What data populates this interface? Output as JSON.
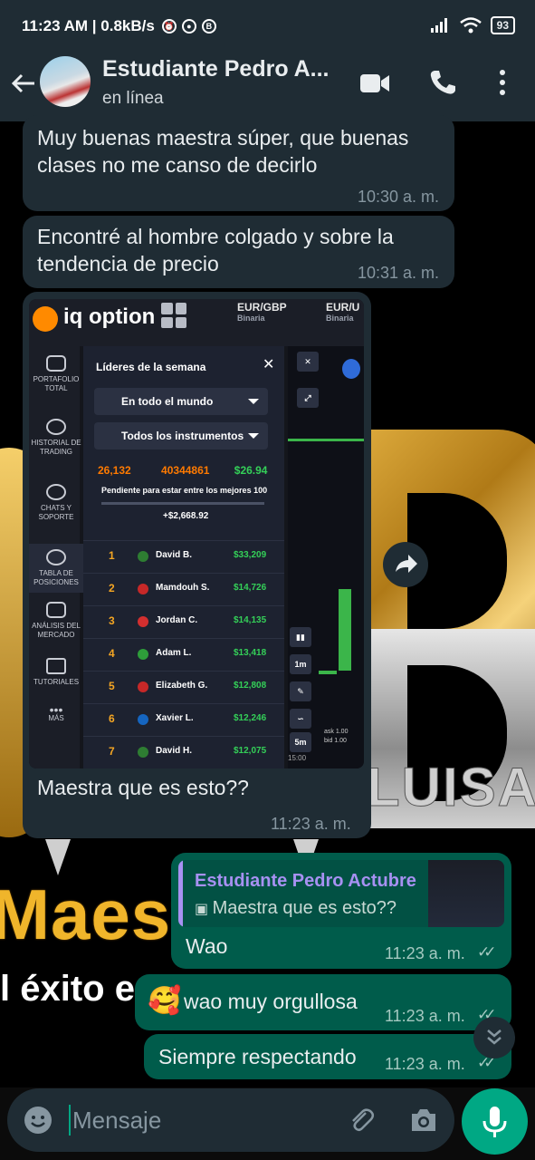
{
  "status_bar": {
    "time_speed": "11:23 AM | 0.8kB/s",
    "battery": "93"
  },
  "chat_header": {
    "name": "Estudiante Pedro A...",
    "status": "en línea"
  },
  "messages": [
    {
      "text": "Muy buenas maestra súper, que buenas clases no me canso de decirlo",
      "time": "10:30 a. m."
    },
    {
      "text": "Encontré al hombre colgado y sobre la tendencia de precio",
      "time": "10:31 a. m."
    },
    {
      "text": "Maestra que es esto??",
      "time": "11:23 a. m."
    },
    {
      "text": "Wao",
      "time": "11:23 a. m."
    },
    {
      "text": "wao muy orgullosa",
      "time": "11:23 a. m."
    },
    {
      "text": "Siempre respectando",
      "time": "11:23 a. m."
    }
  ],
  "reply": {
    "name": "Estudiante Pedro Actubre",
    "text": "Maestra que es esto??"
  },
  "shared_image": {
    "app_name": "iq option",
    "pairs": [
      "EUR/GBP",
      "EUR/U"
    ],
    "pair_type": "Binaria",
    "sidebar": [
      "PORTAFOLIO TOTAL",
      "HISTORIAL DE TRADING",
      "CHATS Y SOPORTE",
      "TABLA DE POSICIONES",
      "ANÁLISIS DEL MERCADO",
      "TUTORIALES",
      "MÁS"
    ],
    "panel_title": "Líderes de la semana",
    "filter_region": "En todo el mundo",
    "filter_instruments": "Todos los instrumentos",
    "my_rank": "26,132",
    "my_id": "40344861",
    "my_amount": "$26.94",
    "pending_label": "Pendiente para estar entre los mejores 100",
    "needed": "+$2,668.92",
    "leaders": [
      {
        "rank": "1",
        "name": "David B.",
        "amount": "$33,209",
        "flag": "#2e7d32"
      },
      {
        "rank": "2",
        "name": "Mamdouh S.",
        "amount": "$14,726",
        "flag": "#c62828"
      },
      {
        "rank": "3",
        "name": "Jordan C.",
        "amount": "$14,135",
        "flag": "#d32f2f"
      },
      {
        "rank": "4",
        "name": "Adam L.",
        "amount": "$13,418",
        "flag": "#2e9d3a"
      },
      {
        "rank": "5",
        "name": "Elizabeth G.",
        "amount": "$12,808",
        "flag": "#c62828"
      },
      {
        "rank": "6",
        "name": "Xavier L.",
        "amount": "$12,246",
        "flag": "#1565c0"
      },
      {
        "rank": "7",
        "name": "David H.",
        "amount": "$12,075",
        "flag": "#2e7d32"
      }
    ],
    "chart_buttons": [
      "1m",
      "5m"
    ],
    "ask": "ask 1.00",
    "bid": "bid 1.00",
    "chart_time": "15:00"
  },
  "wallpaper": {
    "logo_text": "LUISA",
    "banner_text": "Maestr",
    "slogan": "l éxito en t"
  },
  "composer": {
    "placeholder": "Mensaje"
  }
}
